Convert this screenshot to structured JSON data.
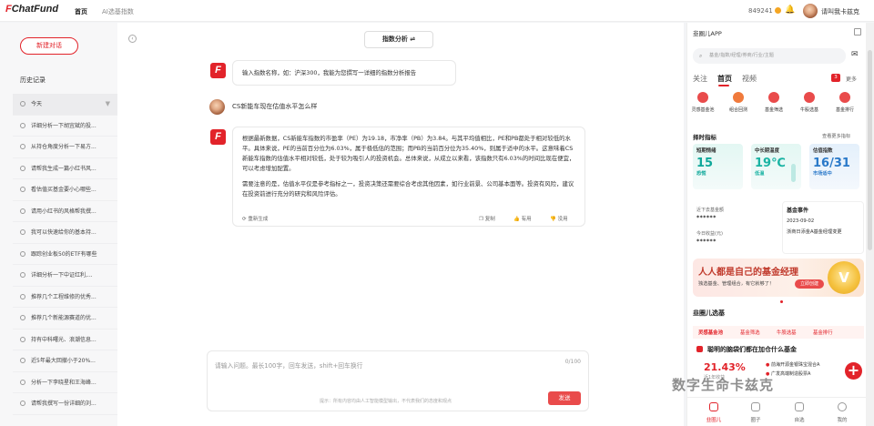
{
  "header": {
    "logo_mark": "F",
    "logo_text": "ChatFund",
    "nav": [
      "首页",
      "AI选基指数"
    ],
    "points": "849241",
    "username": "请叫我卡兹克"
  },
  "sidebar": {
    "new_chat": "新建对话",
    "history_title": "历史记录",
    "items": [
      "今天",
      "详细分析一下胡宜斌的投...",
      "从持仓角度分析一下易方...",
      "请帮我生成一篇小红书风...",
      "看估值买基金要小心哪些...",
      "请用小红书的风格帮我撰...",
      "我可以快速给你的基本持...",
      "跟踪创业板50的ETF有哪些",
      "详细分析一下中证红利,...",
      "推荐几个工程维修的优秀...",
      "推荐几个新能源赛道的优...",
      "持有中科曙光、浪潮信息...",
      "近5年最大回撤小于20%...",
      "分析一下李晓星和王海峰...",
      "请帮我撰写一份详细的刘..."
    ]
  },
  "chat": {
    "mode": "指数分析 ⇌",
    "bot_prompt": "输入指数名称，如：沪深300，我能为您撰写一详细的指数分析报告",
    "user_question": "CS新能车现在估值水平怎么样",
    "response_p1": "根据最新数据，CS新能车指数的市盈率（PE）为19.18，市净率（PB）为3.84。与其平均值相比，PE和PB都处于相对较低的水平。具体来说，PE的当前百分位为6.03%，属于极低估的范围；而PB的当前百分位为35.40%，则属于适中的水平。这意味着CS新能车指数的估值水平相对较低，处于较为吸引人的投资机会。总体来说，从成立以来看，该指数只有6.03%的时间比现在便宜，可以考虑增加配置。",
    "response_p2": "需要注意的是，估值水平仅是参考指标之一，投资决策还需要综合考虑其他因素，如行业前景、公司基本面等。投资有风险，建议在投资前进行充分的研究和风险评估。",
    "regenerate": "重新生成",
    "copy": "复制",
    "like": "有用",
    "dislike": "没用",
    "input_placeholder": "请输入问题。最长100字，回车发送，shift+回车换行",
    "counter": "0/100",
    "send": "发送",
    "disclaimer": "提示：所有内容均由人工智能模型输出，不代表我们的态度和观点"
  },
  "app": {
    "title": "韭圈儿APP",
    "search_placeholder": "基金/指数/经理/券商/行业/主题",
    "tabs": [
      "关注",
      "首页",
      "视频"
    ],
    "more": "更多",
    "badge": "3",
    "shortcuts": [
      "灵感基金池",
      "组合回测",
      "基金筛选",
      "牛股选基",
      "基金排行"
    ],
    "temp_title": "择时指标",
    "temp_link": "查看更多指标",
    "cards": [
      {
        "title": "短期情绪",
        "value": "15",
        "status": "恐慌",
        "color": "#0fa89a"
      },
      {
        "title": "中长期温度",
        "value": "19℃",
        "status": "低温",
        "color": "#1ab3a3"
      },
      {
        "title": "估值指数",
        "value": "16/31",
        "status": "市场适中",
        "color": "#2a79c9"
      }
    ],
    "fund_labels": [
      "近下去基金额",
      "今日收益(元)"
    ],
    "fund_values": [
      "******",
      "******"
    ],
    "event_title": "基金事件",
    "event_date": "2023-09-02",
    "event_text": "浙商日添金A基金经理变更",
    "banner_title": "人人都是自己的基金经理",
    "banner_sub": "独选基金、管理组合，有它就够了！",
    "banner_btn": "立即创建",
    "picks_title": "韭圈儿选基",
    "filter_tabs": [
      "灵感基金池",
      "基金筛选",
      "牛股选基",
      "基金排行"
    ],
    "pick_headline": "聪明的脑袋们都在加仓什么基金",
    "pick_value": "21.43%",
    "pick_label": "近1年收益",
    "pick_items": [
      "前海开源金银珠宝混合A",
      "广发高端制造股票A"
    ],
    "bottom_nav": [
      "韭圈儿",
      "圈子",
      "自选",
      "我的"
    ],
    "watermark": "数字生命卡兹克"
  }
}
